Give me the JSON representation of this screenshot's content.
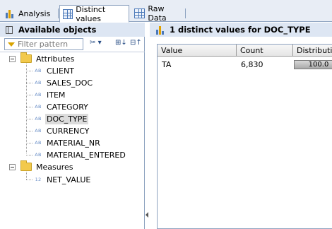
{
  "tabs": [
    {
      "label": "Analysis",
      "icon": "bar-chart-icon"
    },
    {
      "label": "Distinct values",
      "icon": "grid-icon",
      "active": true
    },
    {
      "label": "Raw Data",
      "icon": "table-icon"
    }
  ],
  "left_panel": {
    "title": "Available objects",
    "filter_placeholder": "Filter pattern",
    "toolbar": {
      "tool1": "✂",
      "tool2": "⊞↓",
      "tool3": "⊟↑"
    }
  },
  "tree": {
    "attributes_label": "Attributes",
    "attribute_type": "AB",
    "attributes": [
      "CLIENT",
      "SALES_DOC",
      "ITEM",
      "CATEGORY",
      "DOC_TYPE",
      "CURRENCY",
      "MATERIAL_NR",
      "MATERIAL_ENTERED"
    ],
    "selected": "DOC_TYPE",
    "measures_label": "Measures",
    "measure_type": "12",
    "measures": [
      "NET_VALUE"
    ]
  },
  "right_panel": {
    "title": "1 distinct values for DOC_TYPE",
    "columns": [
      "Value",
      "Count",
      "Distribution"
    ],
    "rows": [
      {
        "value": "TA",
        "count": "6,830",
        "distribution": "100.0"
      }
    ]
  },
  "colors": {
    "accent": "#244a83",
    "header_bg": "#dde6f3",
    "folder": "#f2c94c"
  }
}
